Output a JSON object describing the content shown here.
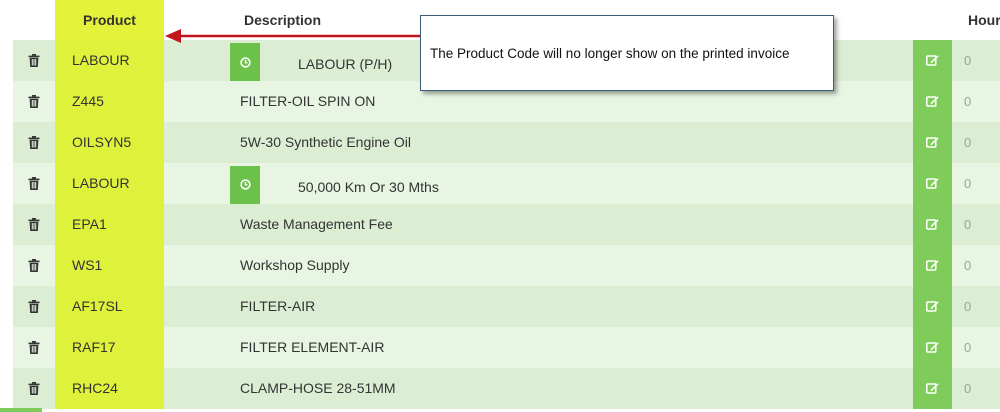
{
  "table": {
    "headers": {
      "product": "Product",
      "description": "Description",
      "hours": "Hour"
    },
    "rows": [
      {
        "product": "LABOUR",
        "description": "LABOUR (P/H)",
        "has_timer": true,
        "hours": "0"
      },
      {
        "product": "Z445",
        "description": "FILTER-OIL SPIN ON",
        "has_timer": false,
        "hours": "0"
      },
      {
        "product": "OILSYN5",
        "description": "5W-30 Synthetic Engine Oil",
        "has_timer": false,
        "hours": "0"
      },
      {
        "product": "LABOUR",
        "description": "50,000 Km Or 30 Mths",
        "has_timer": true,
        "hours": "0"
      },
      {
        "product": "EPA1",
        "description": "Waste Management Fee",
        "has_timer": false,
        "hours": "0"
      },
      {
        "product": "WS1",
        "description": "Workshop Supply",
        "has_timer": false,
        "hours": "0"
      },
      {
        "product": "AF17SL",
        "description": "FILTER-AIR",
        "has_timer": false,
        "hours": "0"
      },
      {
        "product": "RAF17",
        "description": "FILTER ELEMENT-AIR",
        "has_timer": false,
        "hours": "0"
      },
      {
        "product": "RHC24",
        "description": "CLAMP-HOSE 28-51MM",
        "has_timer": false,
        "hours": "0"
      }
    ]
  },
  "annotation": {
    "callout_text": "The Product Code will no longer show on the printed invoice"
  },
  "icons": {
    "delete": "trash-icon",
    "timer": "clock-icon",
    "edit": "edit-icon"
  },
  "colors": {
    "product_highlight": "#dff23b",
    "row_bg": "#dbeed4",
    "row_bg_alt": "#e8f5e2",
    "edit_button": "#7fcc5b",
    "timer_button": "#6cc14a",
    "arrow": "#c0171b"
  }
}
